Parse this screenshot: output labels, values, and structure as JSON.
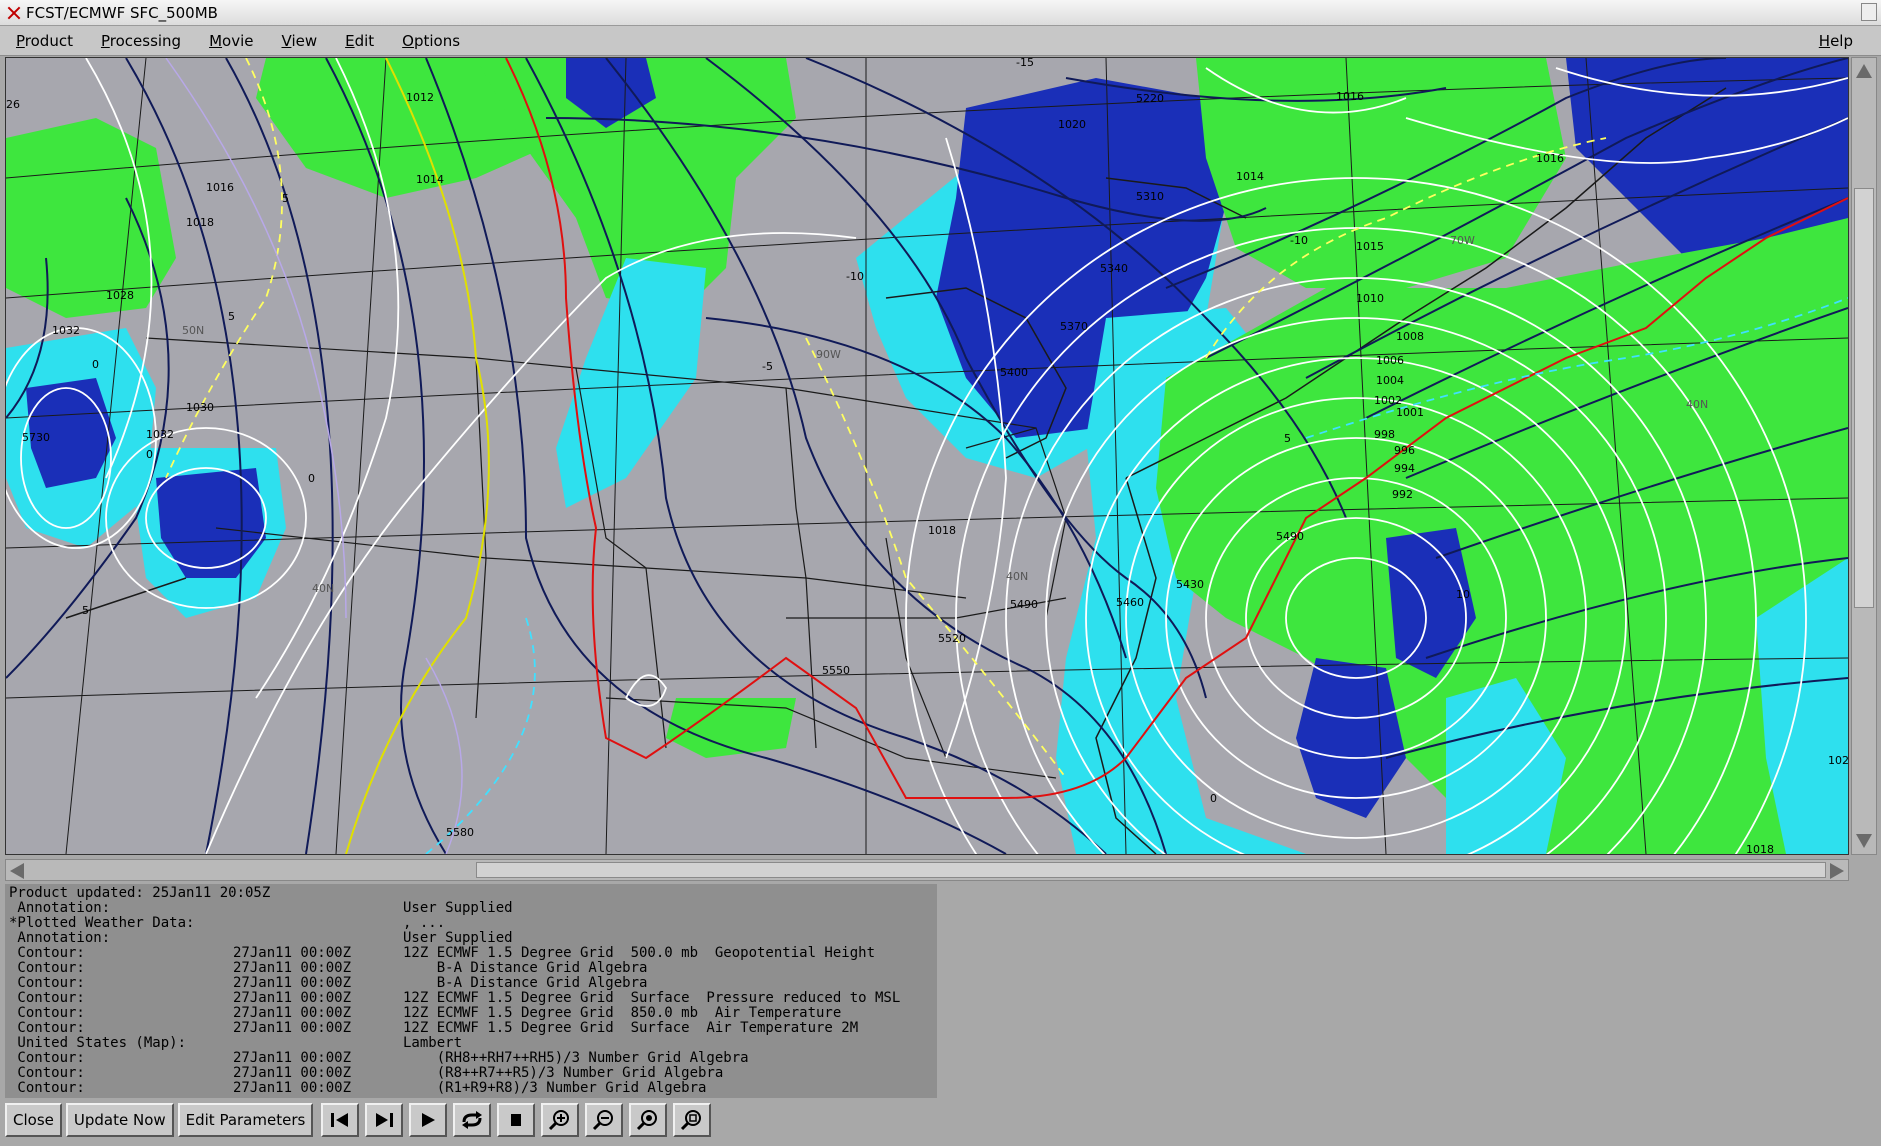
{
  "window": {
    "title": "FCST/ECMWF SFC_500MB"
  },
  "menubar": {
    "items": [
      "Product",
      "Processing",
      "Movie",
      "View",
      "Edit",
      "Options"
    ],
    "help": "Help"
  },
  "map": {
    "colors": {
      "background": "#a7a7ae",
      "rh_green": "#3ee63e",
      "rh_cyan": "#2ee0ee",
      "rh_blue": "#1a2fb8",
      "height_contour": "#101a58",
      "pressure_isobar": "#ffffff",
      "temp_zero": "#e01010",
      "temp_dashed": "#ffff60",
      "temp_cyan_dashed": "#40e0ff",
      "map_outline": "#1a1a1a"
    },
    "labels": {
      "pressure": [
        "1012",
        "1020",
        "1016",
        "1016",
        "1014",
        "1016",
        "1018",
        "1014",
        "1015",
        "1028",
        "1032",
        "1030",
        "1032",
        "1010",
        "1008",
        "1006",
        "1004",
        "1002",
        "1001",
        "998",
        "996",
        "994",
        "992",
        "1018",
        "1018"
      ],
      "heights": [
        "5220",
        "5310",
        "5340",
        "5370",
        "5400",
        "5730",
        "5430",
        "5460",
        "5490",
        "5490",
        "5520",
        "5550",
        "5580"
      ],
      "temps": [
        "-15",
        "-10",
        "-5",
        "5",
        "5",
        "0",
        "0",
        "0",
        "0",
        "5",
        "10",
        "5",
        "-10"
      ],
      "geo": [
        "90W",
        "70W",
        "40N",
        "40N",
        "40N",
        "50N",
        "26",
        "102"
      ]
    }
  },
  "info": {
    "updated": "Product updated: 25Jan11 20:05Z",
    "rows": [
      {
        "c1": " Annotation:",
        "c2": "",
        "c3": "User Supplied"
      },
      {
        "c1": "*Plotted Weather Data:",
        "c2": "",
        "c3": ", ..."
      },
      {
        "c1": " Annotation:",
        "c2": "",
        "c3": "User Supplied"
      },
      {
        "c1": " Contour:",
        "c2": "27Jan11 00:00Z",
        "c3": "12Z ECMWF 1.5 Degree Grid  500.0 mb  Geopotential Height"
      },
      {
        "c1": " Contour:",
        "c2": "27Jan11 00:00Z",
        "c3": "    B-A Distance Grid Algebra"
      },
      {
        "c1": " Contour:",
        "c2": "27Jan11 00:00Z",
        "c3": "    B-A Distance Grid Algebra"
      },
      {
        "c1": " Contour:",
        "c2": "27Jan11 00:00Z",
        "c3": "12Z ECMWF 1.5 Degree Grid  Surface  Pressure reduced to MSL"
      },
      {
        "c1": " Contour:",
        "c2": "27Jan11 00:00Z",
        "c3": "12Z ECMWF 1.5 Degree Grid  850.0 mb  Air Temperature"
      },
      {
        "c1": " Contour:",
        "c2": "27Jan11 00:00Z",
        "c3": "12Z ECMWF 1.5 Degree Grid  Surface  Air Temperature 2M"
      },
      {
        "c1": " United States (Map):",
        "c2": "",
        "c3": "Lambert"
      },
      {
        "c1": " Contour:",
        "c2": "27Jan11 00:00Z",
        "c3": "    (RH8++RH7++RH5)/3 Number Grid Algebra"
      },
      {
        "c1": " Contour:",
        "c2": "27Jan11 00:00Z",
        "c3": "    (R8++R7++R5)/3 Number Grid Algebra"
      },
      {
        "c1": " Contour:",
        "c2": "27Jan11 00:00Z",
        "c3": "    (R1+R9+R8)/3 Number Grid Algebra"
      }
    ]
  },
  "buttons": {
    "close": "Close",
    "update_now": "Update Now",
    "edit_parameters": "Edit Parameters"
  },
  "icons": [
    "first-frame-icon",
    "last-frame-icon",
    "play-icon",
    "loop-icon",
    "stop-icon",
    "zoom-in-icon",
    "zoom-out-icon",
    "zoom-info-icon",
    "zoom-reset-icon"
  ]
}
